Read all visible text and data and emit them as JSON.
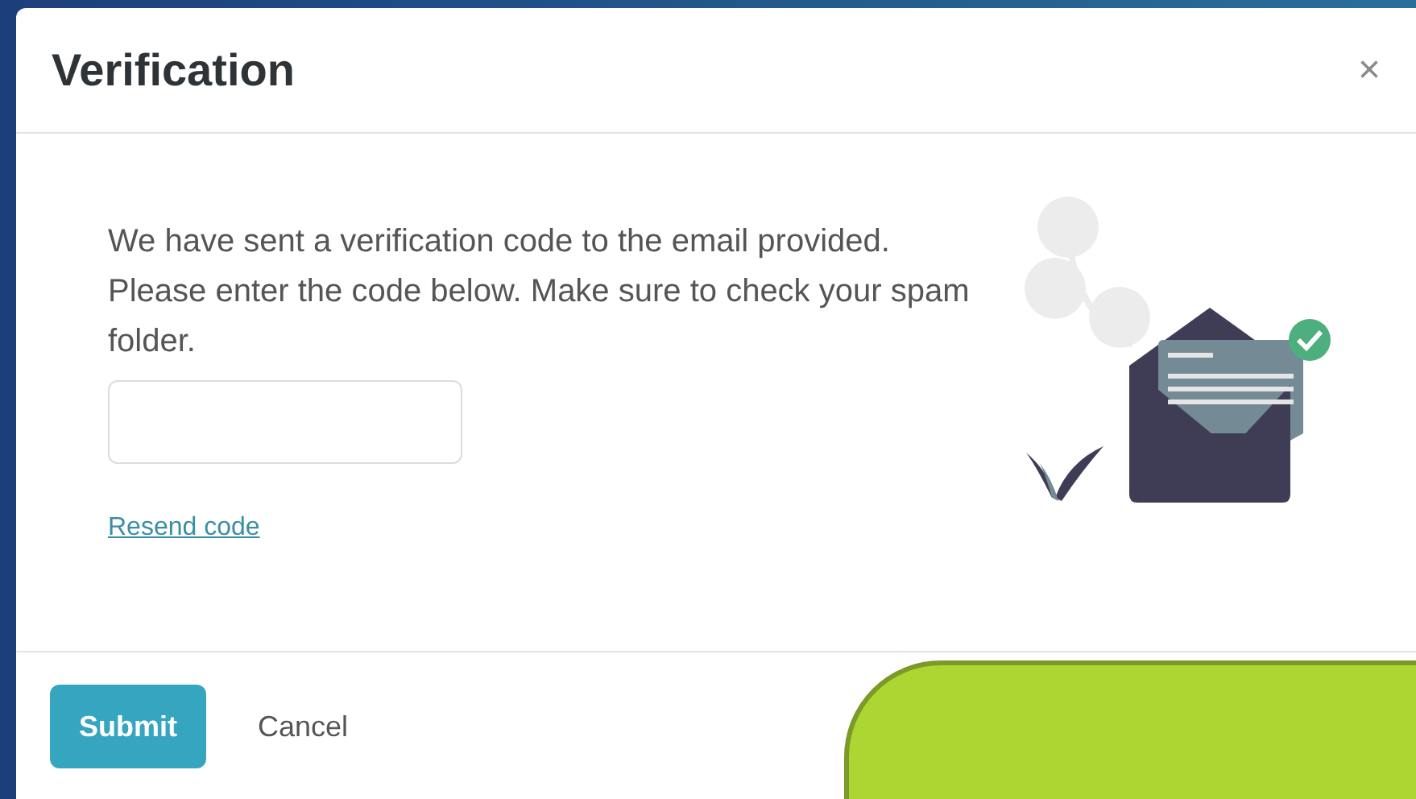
{
  "dialog": {
    "title": "Verification",
    "close_icon": "×",
    "message": "We have sent a verification code to the email provided. Please enter the code below. Make sure to check your spam folder.",
    "resend_link": "Resend code"
  },
  "buttons": [
    {
      "label": "Submit",
      "kind": "primary"
    },
    {
      "label": "Cancel",
      "kind": "plain"
    }
  ]
}
